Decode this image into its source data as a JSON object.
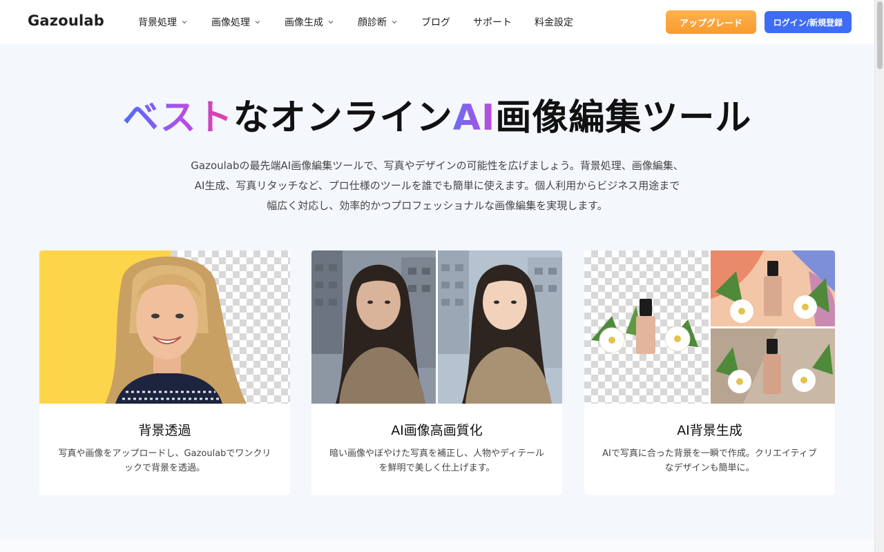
{
  "brand": {
    "name": "Gazoulab"
  },
  "nav": {
    "items": [
      {
        "label": "背景処理",
        "dropdown": true
      },
      {
        "label": "画像処理",
        "dropdown": true
      },
      {
        "label": "画像生成",
        "dropdown": true
      },
      {
        "label": "顔診断",
        "dropdown": true
      },
      {
        "label": "ブログ",
        "dropdown": false
      },
      {
        "label": "サポート",
        "dropdown": false
      },
      {
        "label": "料金設定",
        "dropdown": false
      }
    ]
  },
  "header_buttons": {
    "upgrade_label": "アップグレード",
    "login_label": "ログイン/新規登録"
  },
  "hero": {
    "title_part1": "ベスト",
    "title_part2": "なオンライン",
    "title_part3": "AI",
    "title_part4": "画像編集ツール",
    "description_line1": "Gazoulabの最先端AI画像編集ツールで、写真やデザインの可能性を広げましょう。背景処理、画像編集、",
    "description_line2": "AI生成、写真リタッチなど、プロ仕様のツールを誰でも簡単に使えます。個人利用からビジネス用途まで",
    "description_line3": "幅広く対応し、効率的かつプロフェッショナルな画像編集を実現します。"
  },
  "cards": [
    {
      "title": "背景透過",
      "description": "写真や画像をアップロードし、Gazoulabでワンクリックで背景を透過。"
    },
    {
      "title": "AI画像高画質化",
      "description": "暗い画像やぼやけた写真を補正し、人物やディテールを鮮明で美しく仕上げます。"
    },
    {
      "title": "AI背景生成",
      "description": "AIで写真に合った背景を一瞬で作成。クリエイティブなデザインも簡単に。"
    }
  ],
  "colors": {
    "accent_blue": "#3e6cf5",
    "upgrade_orange": "#f79b2e",
    "page_background": "#f4f7fc"
  }
}
